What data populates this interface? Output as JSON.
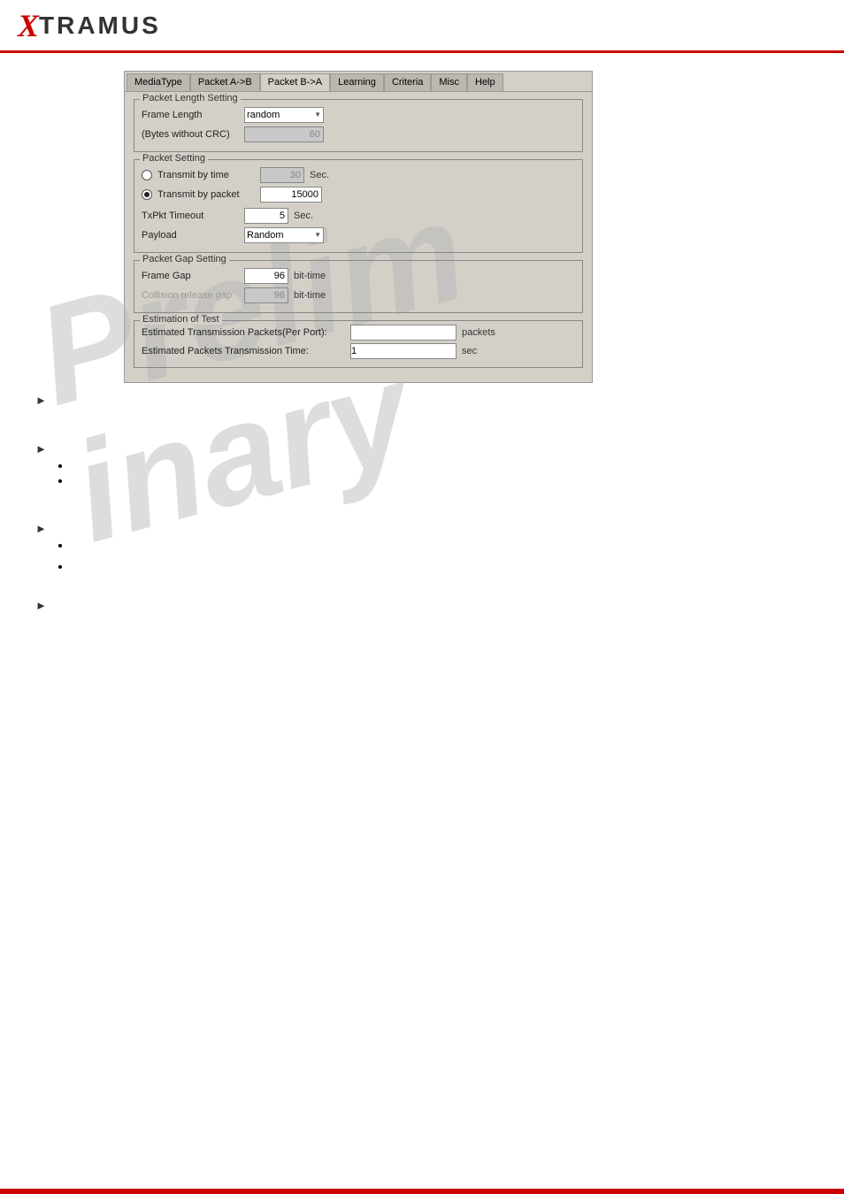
{
  "header": {
    "logo_x": "X",
    "logo_tramus": "TRAMUS"
  },
  "tabs": {
    "items": [
      {
        "label": "MediaType",
        "active": false
      },
      {
        "label": "Packet A->B",
        "active": false
      },
      {
        "label": "Packet B->A",
        "active": true
      },
      {
        "label": "Learning",
        "active": false
      },
      {
        "label": "Criteria",
        "active": false
      },
      {
        "label": "Misc",
        "active": false
      },
      {
        "label": "Help",
        "active": false
      }
    ]
  },
  "packet_length_setting": {
    "group_label": "Packet Length Setting",
    "frame_length_label": "Frame Length",
    "frame_length_value": "random",
    "bytes_label": "(Bytes without CRC)",
    "bytes_value": "60"
  },
  "packet_setting": {
    "group_label": "Packet Setting",
    "transmit_by_time_label": "Transmit by time",
    "transmit_by_time_value": "30",
    "transmit_by_time_unit": "Sec.",
    "transmit_by_packet_label": "Transmit by packet",
    "transmit_by_packet_value": "15000",
    "txpkt_timeout_label": "TxPkt Timeout",
    "txpkt_timeout_value": "5",
    "txpkt_timeout_unit": "Sec.",
    "payload_label": "Payload",
    "payload_value": "Random"
  },
  "packet_gap_setting": {
    "group_label": "Packet Gap Setting",
    "frame_gap_label": "Frame Gap",
    "frame_gap_value": "96",
    "frame_gap_unit": "bit-time",
    "collision_release_label": "Collision release gap",
    "collision_release_value": "96",
    "collision_release_unit": "bit-time"
  },
  "estimation": {
    "group_label": "Estimation of Test",
    "transmission_packets_label": "Estimated Transmission Packets(Per Port):",
    "transmission_packets_value": "",
    "transmission_packets_unit": "packets",
    "transmission_time_label": "Estimated Packets Transmission Time:",
    "transmission_time_value": "1",
    "transmission_time_unit": "sec"
  },
  "watermark": "Prelim..."
}
